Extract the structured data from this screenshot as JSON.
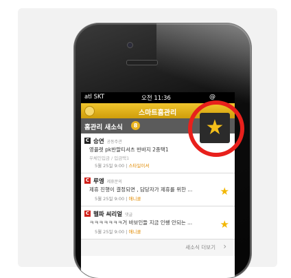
{
  "status": {
    "carrier": "atl SKT",
    "time": "오전 11:36",
    "battery": "@"
  },
  "nav": {
    "title": "스마트홈관리"
  },
  "section": {
    "title": "홈관리 새소식",
    "count": "8"
  },
  "items": [
    {
      "logo": "C",
      "name": "승연",
      "category": "공동주관",
      "line1": "영플렛 pk반팔티셔츠 반바지 2종택1",
      "line2": "우체인입금 / 입금택1",
      "date": "5월 25일 9:00",
      "tag": "스타일이셔",
      "starred": false
    },
    {
      "logo": "C",
      "name": "루엥",
      "category": "제휴문의",
      "line1": "제휴 진행이 결정되면 , 담당자가 제휴를 위한 ...",
      "date": "5월 25일 9:00",
      "tag": "애니콜",
      "starred": true
    },
    {
      "logo": "C",
      "name": "헬파 씨리얼",
      "category": "댓글",
      "line1": "ㅋㅋㅋㅋㅋㅋㅋ거 바보인들 지금 인쌩 안되는 ...",
      "date": "5월 25일 9:00",
      "tag": "애니콜",
      "starred": true
    }
  ],
  "more": {
    "label": "새소식 더보기"
  },
  "colors": {
    "accent": "#e8201c",
    "star": "#f2b705",
    "navbar": "#e0b019"
  },
  "icons": {
    "highlight": "star-icon",
    "more": "chevron-right-icon"
  }
}
